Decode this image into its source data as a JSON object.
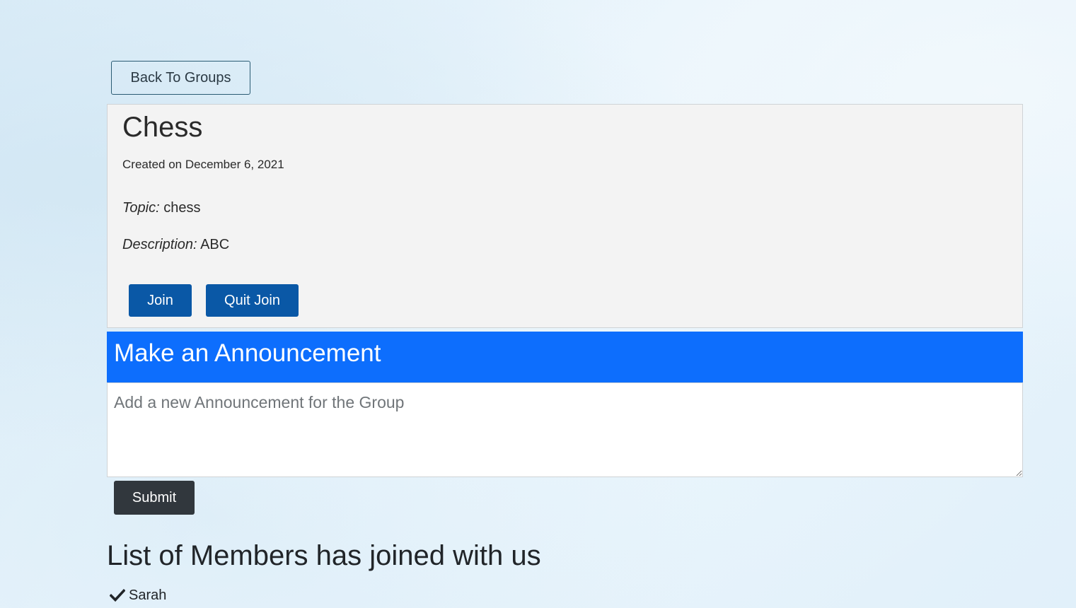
{
  "nav": {
    "back_label": "Back To Groups"
  },
  "group": {
    "title": "Chess",
    "created_line": "Created on December 6, 2021",
    "topic_label": "Topic:",
    "topic_value": "chess",
    "description_label": "Description:",
    "description_value": "ABC",
    "join_label": "Join",
    "quit_label": "Quit Join"
  },
  "announcement": {
    "heading": "Make an Announcement",
    "placeholder": "Add a new Announcement for the Group",
    "value": "",
    "submit_label": "Submit"
  },
  "members": {
    "heading": "List of Members has joined with us",
    "items": [
      {
        "name": "Sarah",
        "icon": "check-icon"
      }
    ]
  },
  "colors": {
    "primary_button": "#0a58a6",
    "announcement_header": "#0d6efd",
    "submit_button": "#31373d",
    "card_background": "#f3f3f3"
  }
}
